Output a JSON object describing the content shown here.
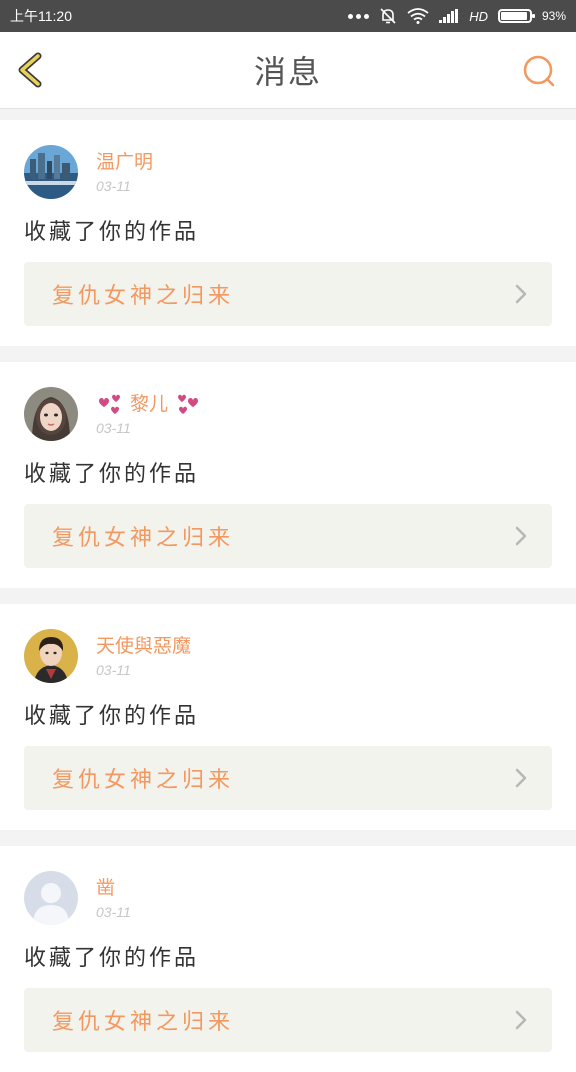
{
  "status_bar": {
    "time": "上午11:20",
    "network": "HD",
    "battery": "93%",
    "battery_level": 0.93
  },
  "header": {
    "title": "消息",
    "back_icon": "chevron-left-icon",
    "search_icon": "search-icon",
    "accent_color": "#f39860",
    "back_color": "#e9d25a"
  },
  "messages": [
    {
      "username": "温广明",
      "date": "03-11",
      "action": "收藏了你的作品",
      "work_title": "复仇女神之归来"
    },
    {
      "username": "黎儿",
      "date": "03-11",
      "action": "收藏了你的作品",
      "work_title": "复仇女神之归来"
    },
    {
      "username": "天使與惡魔",
      "date": "03-11",
      "action": "收藏了你的作品",
      "work_title": "复仇女神之归来"
    },
    {
      "username": "凿",
      "date": "03-11",
      "action": "收藏了你的作品",
      "work_title": "复仇女神之归来"
    }
  ]
}
